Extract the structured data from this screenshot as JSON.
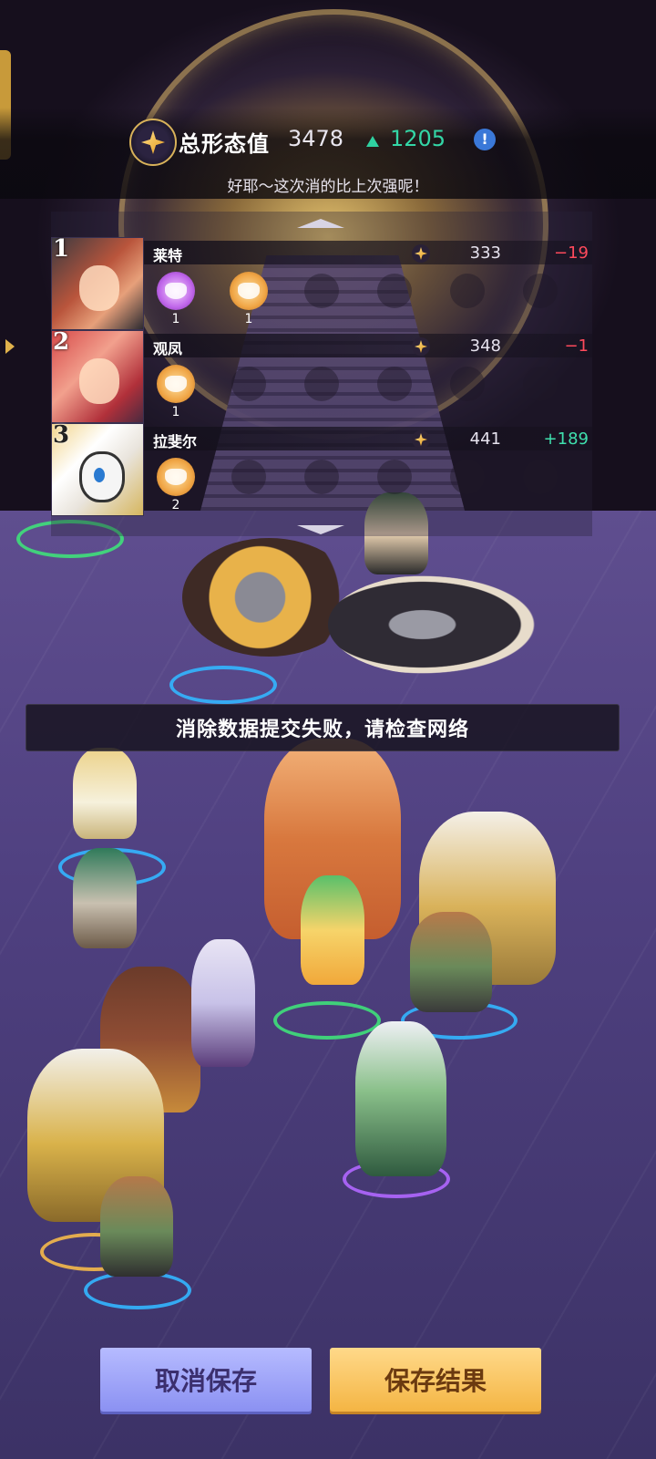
{
  "header": {
    "score_title": "总形态值",
    "score_value": "3478",
    "score_delta": "1205",
    "subtitle": "好耶～这次消的比上次强呢！",
    "score_icon": "gold-star-icon",
    "delta_icon": "up-triangle-icon",
    "info_icon_text": "!"
  },
  "ranking": {
    "rows": [
      {
        "rank": "1",
        "name": "莱特",
        "value": "333",
        "delta": "−19",
        "delta_sign": "negative",
        "masks": [
          {
            "type": "purple-mask",
            "count": "1"
          },
          {
            "type": "gold-mask",
            "count": "1"
          }
        ]
      },
      {
        "rank": "2",
        "name": "观凤",
        "value": "348",
        "delta": "−1",
        "delta_sign": "negative",
        "masks": [
          {
            "type": "gold-mask",
            "count": "1"
          }
        ]
      },
      {
        "rank": "3",
        "name": "拉斐尔",
        "value": "441",
        "delta": "+189",
        "delta_sign": "positive",
        "masks": [
          {
            "type": "gold-mask",
            "count": "2"
          }
        ]
      }
    ]
  },
  "toast": {
    "message": "消除数据提交失败，请检查网络"
  },
  "buttons": {
    "cancel_label": "取消保存",
    "save_label": "保存结果"
  },
  "colors": {
    "positive": "#3fe0ae",
    "negative": "#ff4a5c",
    "cancel_button": "#9ca1f8",
    "save_button": "#f8c35e"
  }
}
